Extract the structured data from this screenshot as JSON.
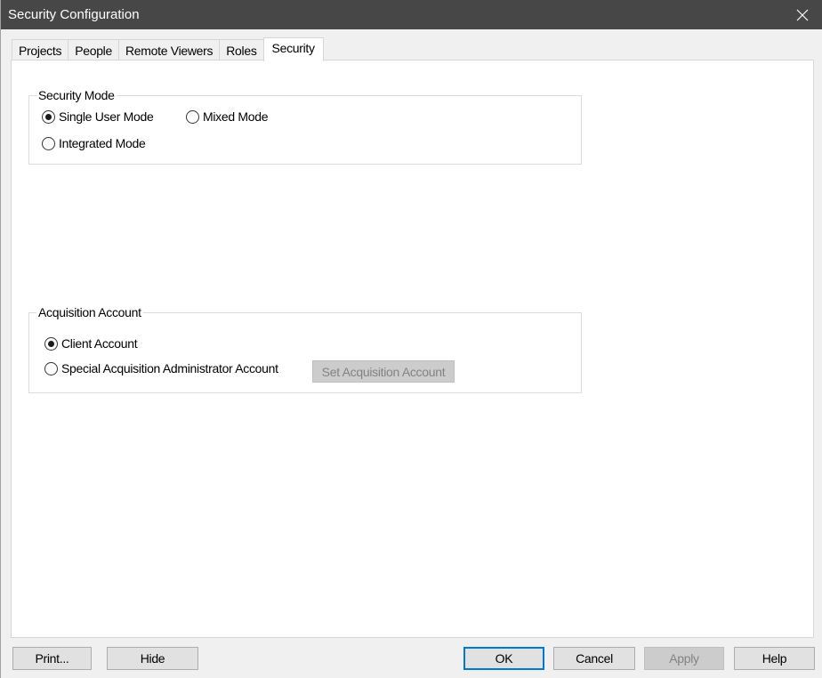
{
  "window": {
    "title": "Security Configuration"
  },
  "tabs": [
    {
      "label": "Projects",
      "active": false
    },
    {
      "label": "People",
      "active": false
    },
    {
      "label": "Remote Viewers",
      "active": false
    },
    {
      "label": "Roles",
      "active": false
    },
    {
      "label": "Security",
      "active": true
    }
  ],
  "security_mode": {
    "label": "Security Mode",
    "options": [
      {
        "label": "Single User Mode",
        "checked": true
      },
      {
        "label": "Mixed Mode",
        "checked": false
      },
      {
        "label": "Integrated Mode",
        "checked": false
      }
    ]
  },
  "acquisition_account": {
    "label": "Acquisition Account",
    "options": [
      {
        "label": "Client Account",
        "checked": true
      },
      {
        "label": "Special Acquisition Administrator Account",
        "checked": false
      }
    ],
    "set_button_label": "Set Acquisition Account",
    "set_button_enabled": false
  },
  "footer": {
    "print_label": "Print...",
    "hide_label": "Hide",
    "ok_label": "OK",
    "cancel_label": "Cancel",
    "apply_label": "Apply",
    "apply_enabled": false,
    "help_label": "Help"
  },
  "colors": {
    "titlebar": "#474747",
    "default_button_border": "#0078d7"
  },
  "icons": {
    "close": "close-icon"
  }
}
